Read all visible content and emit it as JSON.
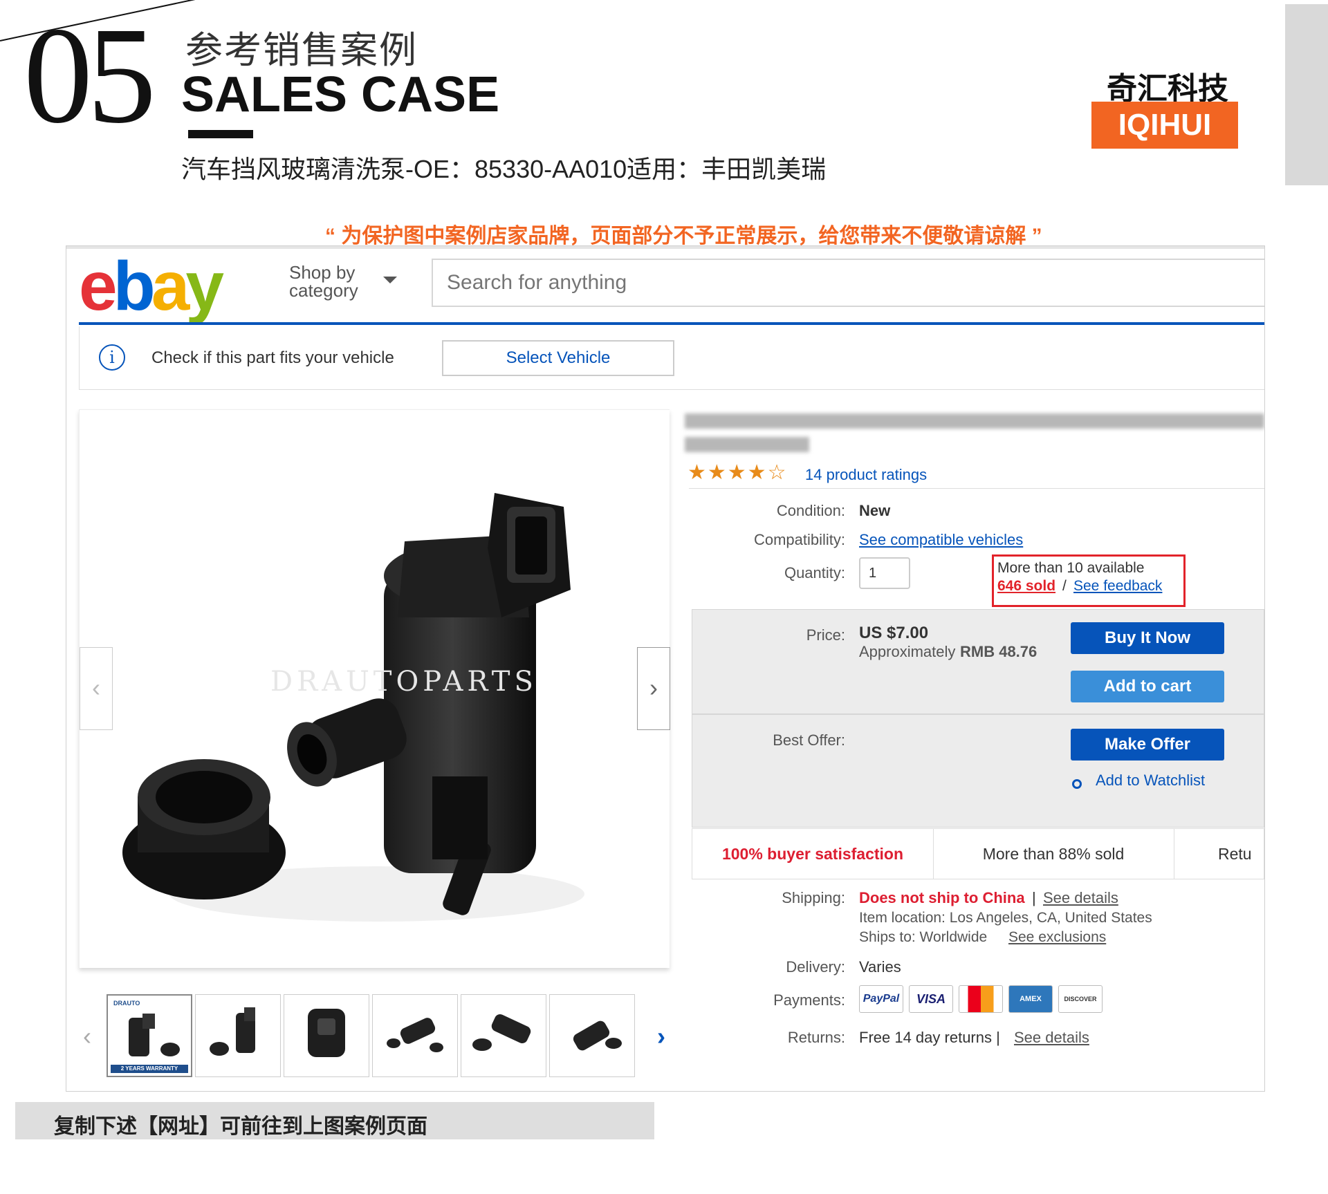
{
  "header": {
    "number": "05",
    "title_cn": "参考销售案例",
    "title_en": "SALES CASE",
    "subtitle": "汽车挡风玻璃清洗泵-OE：85330-AA010适用：丰田凯美瑞"
  },
  "brand": {
    "name_cn": "奇汇科技",
    "name_en": "IQIHUI",
    "accent": "#f26522"
  },
  "notice": "“ 为保护图中案例店家品牌，页面部分不予正常展示，给您带来不便敬请谅解 ”",
  "ebay": {
    "logo": {
      "letters": [
        "e",
        "b",
        "a",
        "y"
      ],
      "colors": [
        "#e53238",
        "#0064d2",
        "#f5af02",
        "#86b817"
      ]
    },
    "shop_by_line1": "Shop by",
    "shop_by_line2": "category",
    "search_placeholder": "Search for anything",
    "fit": {
      "text": "Check if this part fits your vehicle",
      "button": "Select Vehicle"
    },
    "gallery": {
      "watermark": "DRAUTOPARTS",
      "thumb_badge": "DRAUTO",
      "thumb_warranty": "2 YEARS WARRANTY"
    },
    "rating": {
      "stars": "★★★★☆",
      "text": "14 product ratings"
    },
    "details": {
      "condition_label": "Condition:",
      "condition_value": "New",
      "compat_label": "Compatibility:",
      "compat_link": "See compatible vehicles",
      "qty_label": "Quantity:",
      "qty_value": "1",
      "available": "More than 10 available",
      "sold": "646 sold",
      "sold_sep": "/",
      "feedback": "See feedback"
    },
    "price": {
      "label": "Price:",
      "value": "US $7.00",
      "approx_prefix": "Approximately",
      "approx_value": "RMB 48.76",
      "buy_now": "Buy It Now",
      "add_cart": "Add to cart",
      "offer_label": "Best Offer:",
      "make_offer": "Make Offer",
      "watchlist": "Add to Watchlist"
    },
    "satisfaction": [
      "100% buyer satisfaction",
      "More than 88% sold",
      "Retu"
    ],
    "shipping": {
      "label": "Shipping:",
      "value": "Does not ship to China",
      "sep": "|",
      "details": "See details",
      "location": "Item location: Los Angeles, CA, United States",
      "ships_to": "Ships to: Worldwide",
      "exclusions": "See exclusions",
      "delivery_label": "Delivery:",
      "delivery_value": "Varies",
      "payments_label": "Payments:",
      "payments": [
        "PayPal",
        "VISA",
        "MC",
        "AMEX",
        "DISCOVER"
      ],
      "returns_label": "Returns:",
      "returns_value": "Free 14 day returns |",
      "returns_link": "See details"
    }
  },
  "footer": "复制下述【网址】可前往到上图案例页面"
}
